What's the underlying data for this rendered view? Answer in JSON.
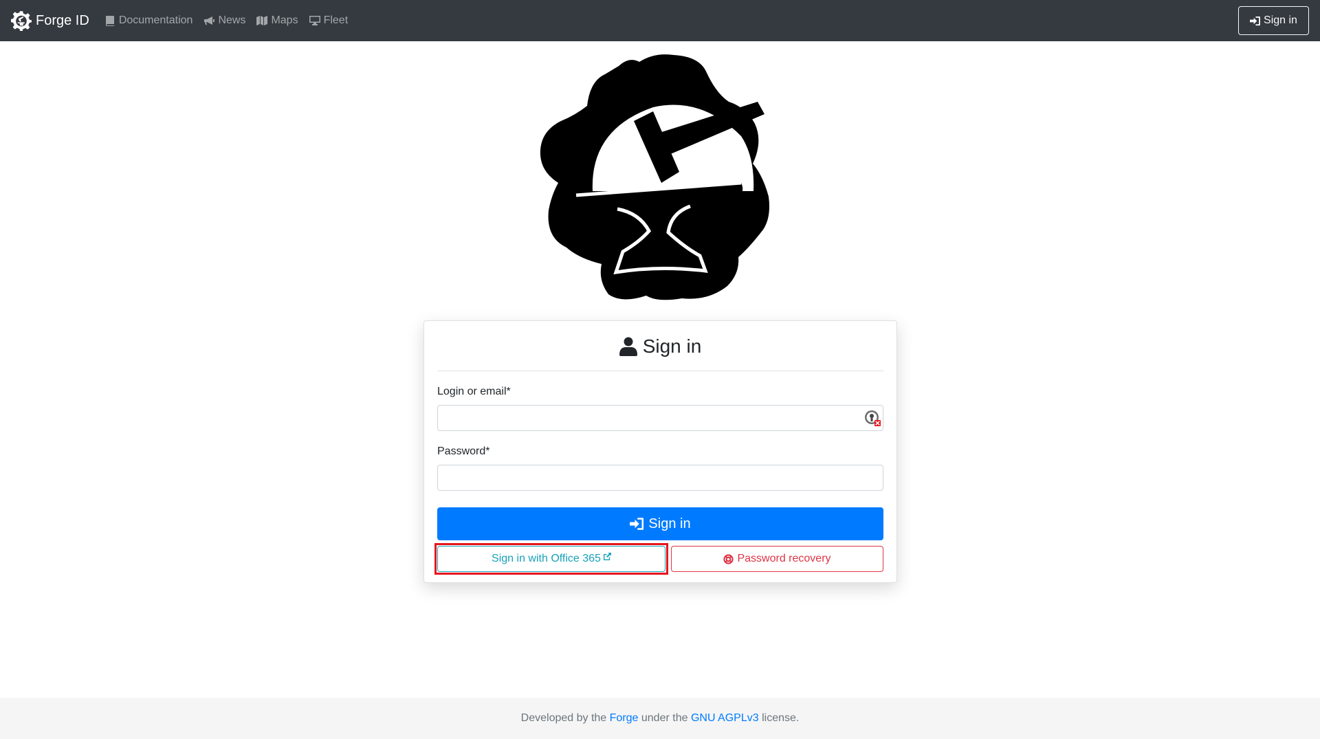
{
  "navbar": {
    "brand": "Forge ID",
    "items": [
      {
        "label": "Documentation",
        "icon": "book-icon"
      },
      {
        "label": "News",
        "icon": "megaphone-icon"
      },
      {
        "label": "Maps",
        "icon": "map-icon"
      },
      {
        "label": "Fleet",
        "icon": "desktop-icon"
      }
    ],
    "signin_label": "Sign in"
  },
  "card": {
    "title": "Sign in",
    "login_label": "Login or email*",
    "login_value": "",
    "password_label": "Password*",
    "password_value": "",
    "signin_button": "Sign in",
    "office365_button": "Sign in with Office 365",
    "password_recovery_button": "Password recovery"
  },
  "footer": {
    "text1": "Developed by the ",
    "link1": "Forge",
    "text2": " under the ",
    "link2": "GNU AGPLv3",
    "text3": " license."
  },
  "colors": {
    "navbar_bg": "#343a40",
    "primary": "#007bff",
    "info": "#17a2b8",
    "danger": "#dc3545",
    "highlight": "#e8141c"
  }
}
